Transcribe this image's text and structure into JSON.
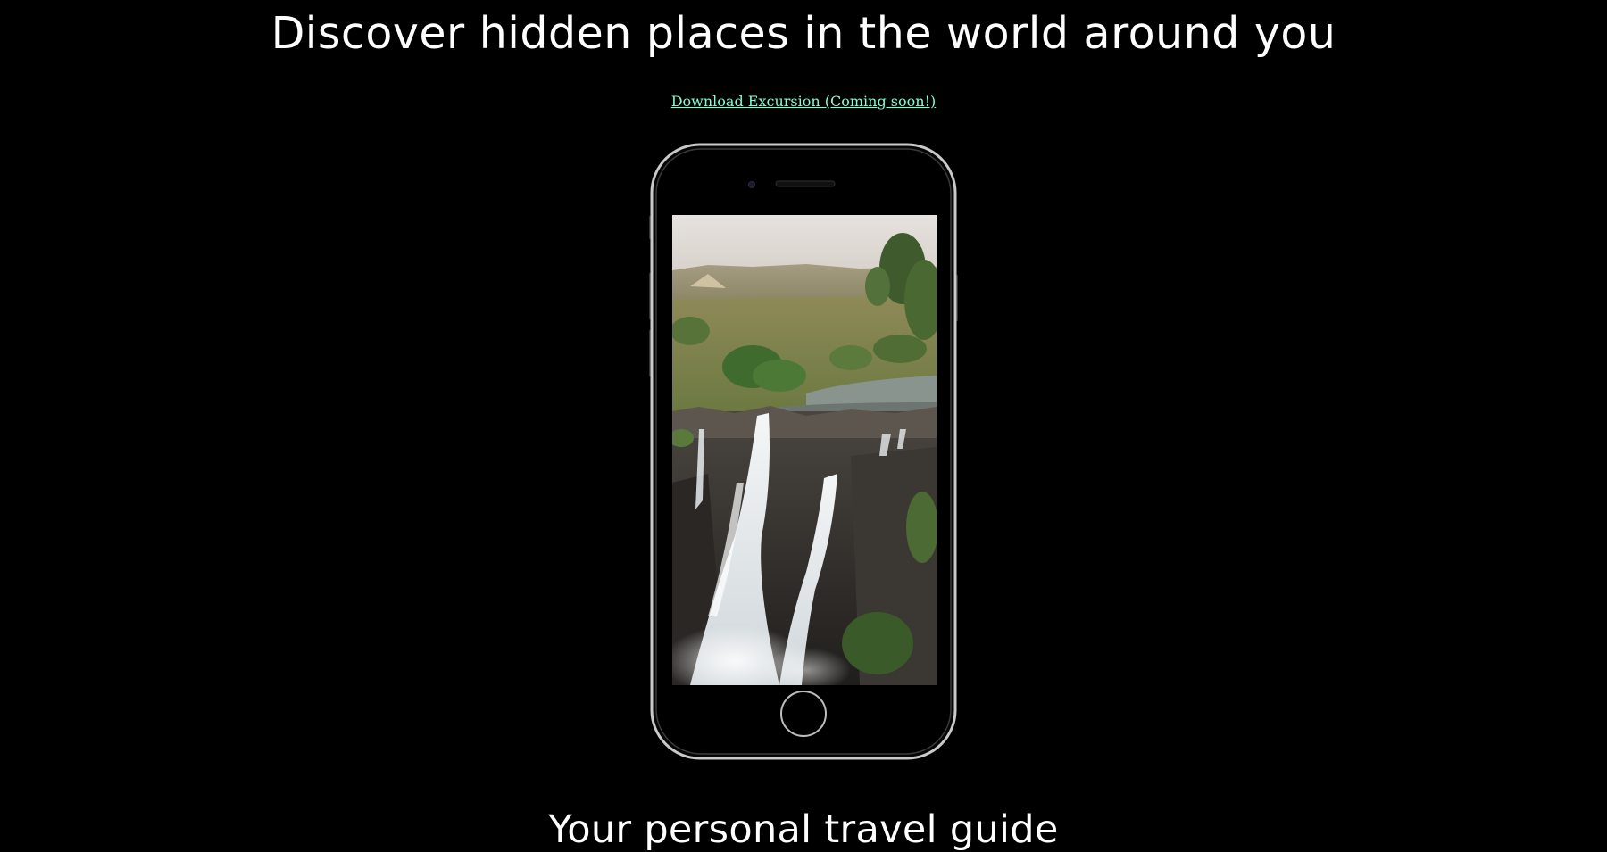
{
  "hero": {
    "title": "Discover hidden places in the world around you",
    "download_label": "Download Excursion (Coming soon!)"
  },
  "phone": {
    "screen_content": "waterfall video"
  },
  "tagline": {
    "text": "Your personal travel guide"
  },
  "colors": {
    "background": "#000000",
    "text": "#ffffff",
    "link": "#7fffd4"
  }
}
